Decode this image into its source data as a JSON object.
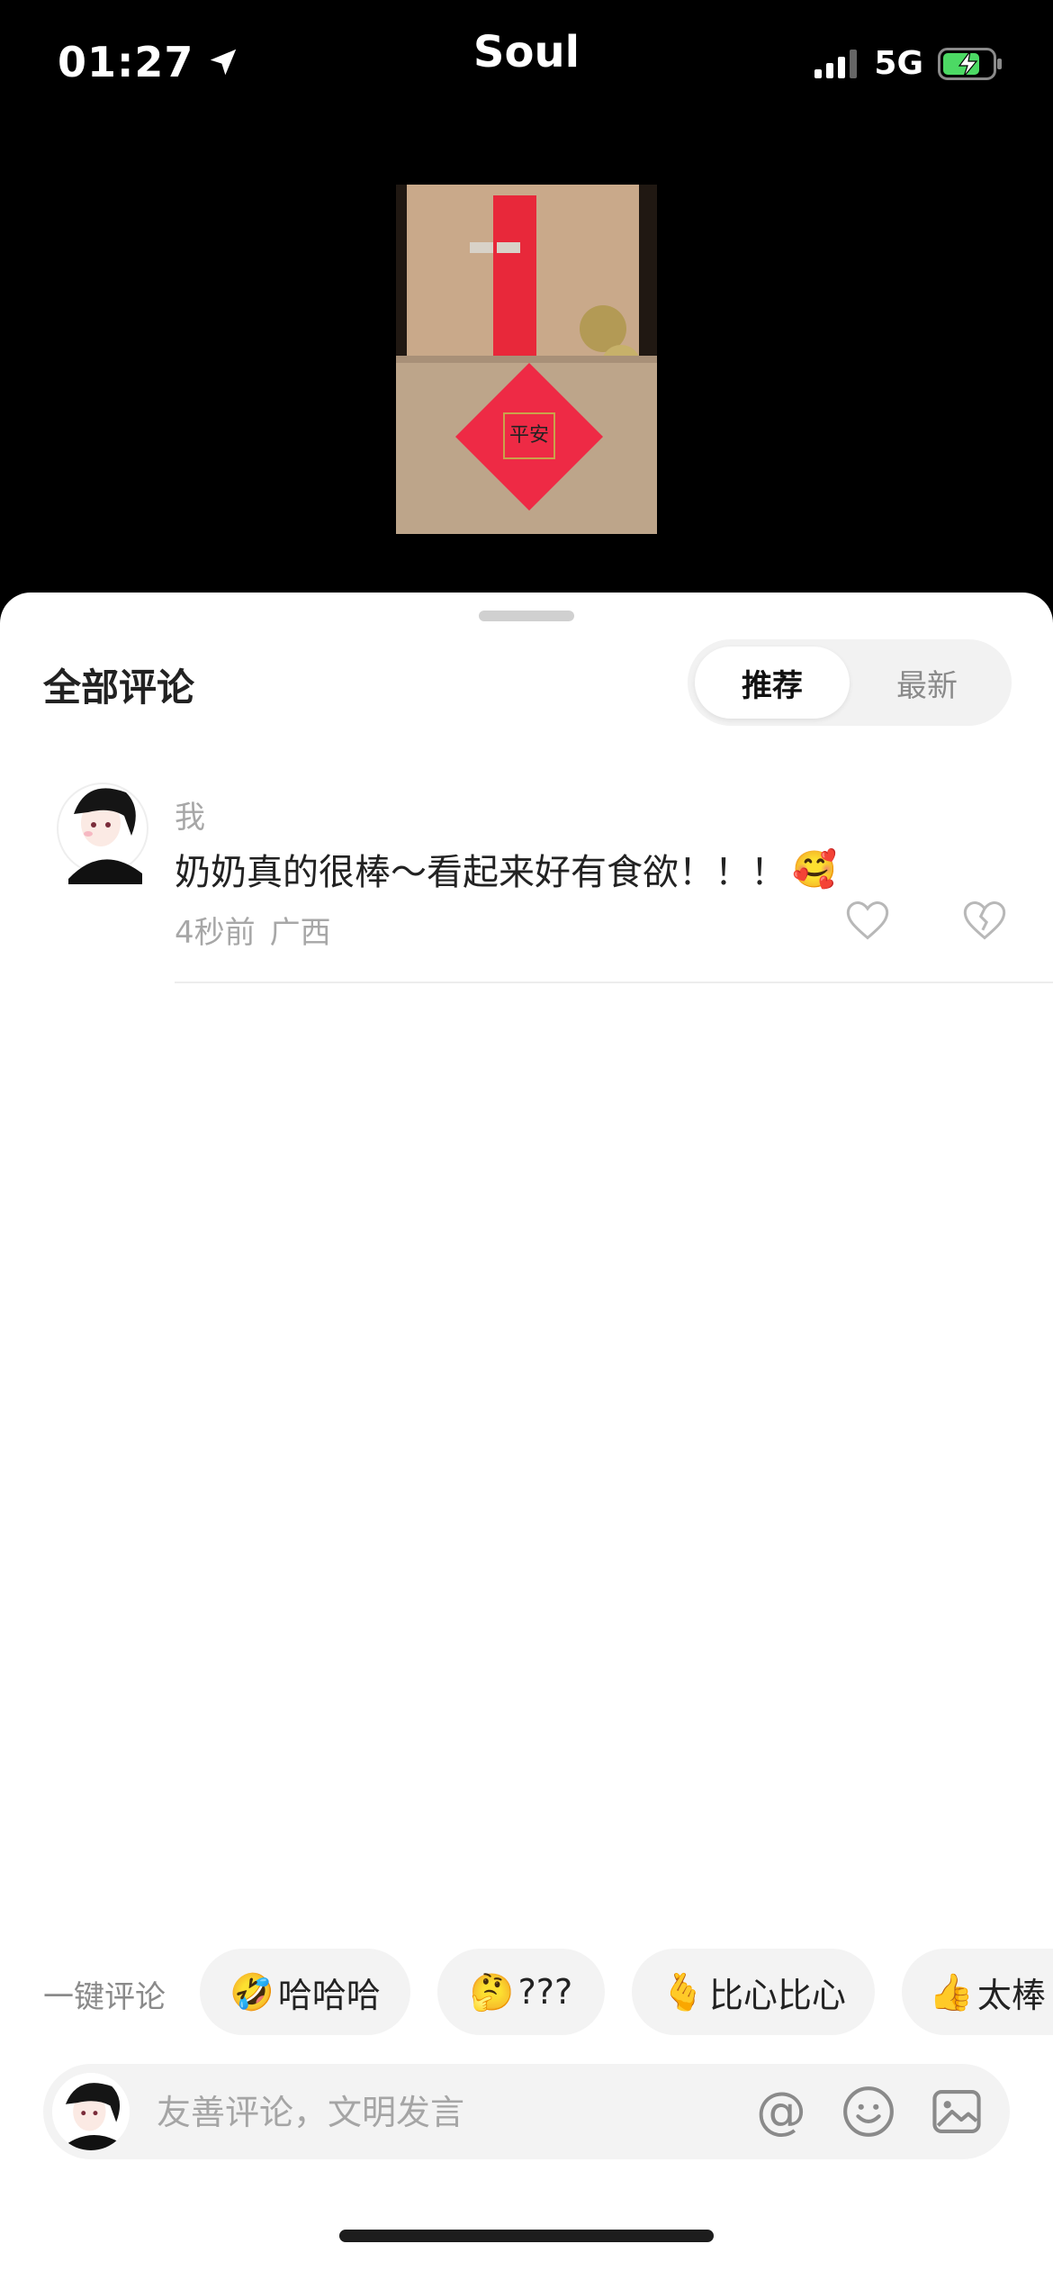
{
  "status_bar": {
    "time": "01:27",
    "app_title": "Soul",
    "network": "5G"
  },
  "comments_sheet": {
    "title": "全部评论",
    "sort_options": [
      {
        "label": "推荐",
        "active": true
      },
      {
        "label": "最新",
        "active": false
      }
    ],
    "comments": [
      {
        "author": "我",
        "text": "奶奶真的很棒～看起来好有食欲！！！",
        "emoji": "🥰",
        "time": "4秒前",
        "location": "广西"
      }
    ]
  },
  "quick_comment": {
    "label": "一键评论",
    "chips": [
      {
        "emoji": "🤣",
        "text": "哈哈哈"
      },
      {
        "emoji": "🤔",
        "text": "???"
      },
      {
        "emoji": "🫰",
        "text": "比心比心"
      },
      {
        "emoji": "👍",
        "text": "太棒"
      }
    ]
  },
  "input_bar": {
    "placeholder": "友善评论，文明发言",
    "at_symbol": "@"
  },
  "colors": {
    "background_top": "#000000",
    "sheet": "#ffffff",
    "muted_text": "#a7a7a7",
    "chip_bg": "#f3f3f3",
    "charging_green": "#4cd964"
  },
  "icons": [
    "location-arrow-icon",
    "signal-icon",
    "battery-charging-icon",
    "heart-icon",
    "broken-heart-icon",
    "at-icon",
    "emoji-icon",
    "image-icon"
  ]
}
